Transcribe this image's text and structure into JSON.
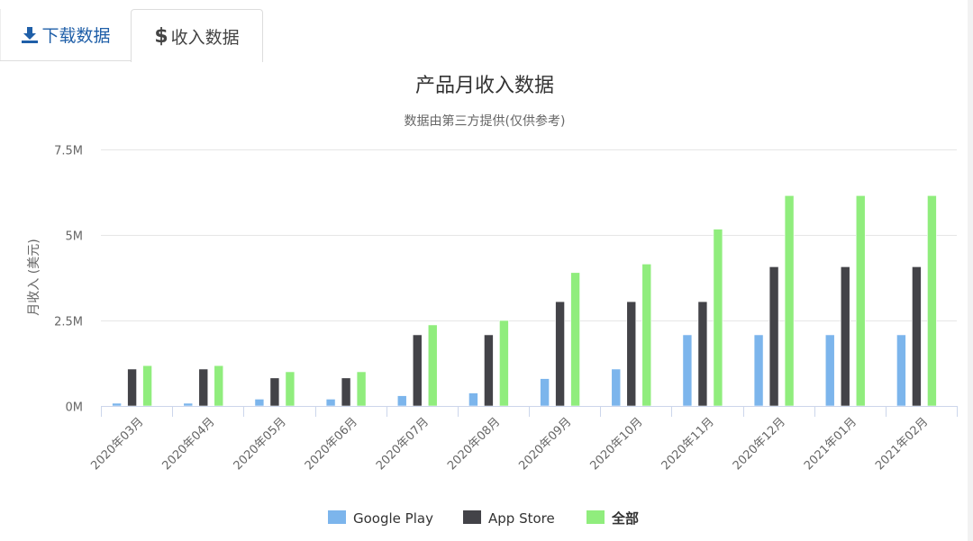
{
  "tabs": [
    {
      "label": "下载数据",
      "icon": "download-icon",
      "active": false
    },
    {
      "label": "收入数据",
      "icon": "dollar-icon",
      "icon_glyph": "$",
      "active": true
    }
  ],
  "colors": {
    "google_play": "#7cb5ec",
    "app_store": "#434348",
    "all": "#90ed7d",
    "tab_link": "#1f5fa8"
  },
  "chart_data": {
    "type": "bar",
    "title": "产品月收入数据",
    "subtitle": "数据由第三方提供(仅供参考)",
    "xlabel": "",
    "ylabel": "月收入 (美元)",
    "ylim": [
      0,
      7500000
    ],
    "yticks": [
      0,
      2500000,
      5000000,
      7500000
    ],
    "ytick_labels": [
      "0M",
      "2.5M",
      "5M",
      "7.5M"
    ],
    "grid": true,
    "legend_position": "bottom-center",
    "categories": [
      "2020年03月",
      "2020年04月",
      "2020年05月",
      "2020年06月",
      "2020年07月",
      "2020年08月",
      "2020年09月",
      "2020年10月",
      "2020年11月",
      "2020年12月",
      "2021年01月",
      "2021年02月"
    ],
    "series": [
      {
        "name": "Google Play",
        "color": "#7cb5ec",
        "values": [
          80000,
          80000,
          200000,
          200000,
          300000,
          380000,
          800000,
          1080000,
          2080000,
          2080000,
          2080000,
          2080000
        ]
      },
      {
        "name": "App Store",
        "color": "#434348",
        "values": [
          1080000,
          1080000,
          820000,
          820000,
          2080000,
          2080000,
          3050000,
          3050000,
          3050000,
          4070000,
          4070000,
          4070000
        ]
      },
      {
        "name": "全部",
        "color": "#90ed7d",
        "values": [
          1180000,
          1180000,
          1000000,
          1000000,
          2370000,
          2500000,
          3900000,
          4150000,
          5170000,
          6150000,
          6150000,
          6150000
        ]
      }
    ]
  }
}
